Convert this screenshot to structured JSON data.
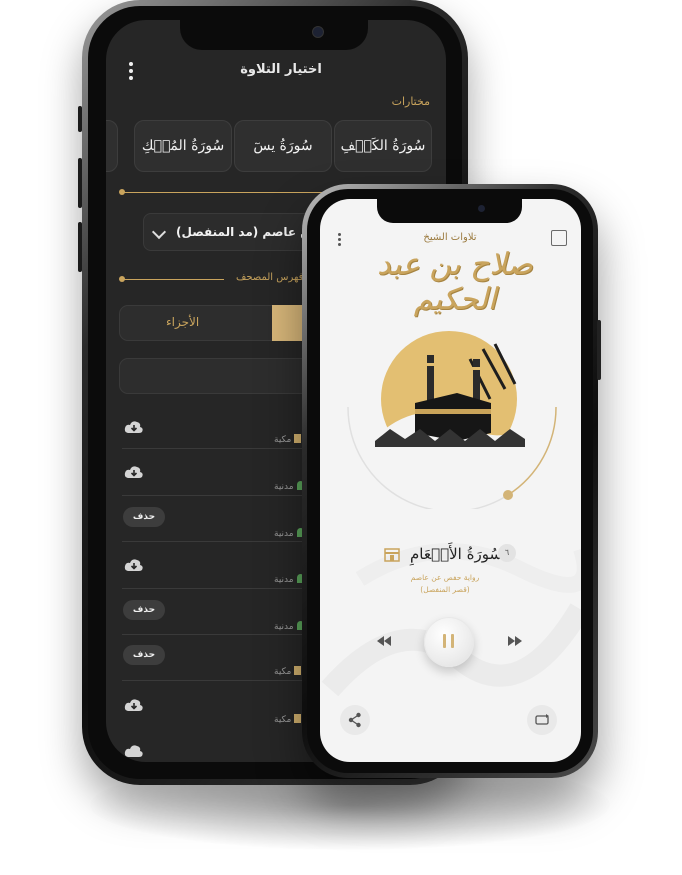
{
  "back_screen": {
    "title": "اختيار التلاوة",
    "favorites_label": "مختارات",
    "favorites": [
      "سُورَةُ الكَهۡفِ",
      "سُورَةُ يسٓ",
      "سُورَةُ المُلۡكِ"
    ],
    "riwaya_select": "عن عاصم (مد المنفصل)",
    "index_label": "فهرس المصحف",
    "tab_parts": "الأجزاء",
    "delete_label": "حذف",
    "rows": [
      {
        "type": "مكية",
        "action": "download"
      },
      {
        "type": "مدنية",
        "action": "download"
      },
      {
        "type": "مدنية",
        "action": "delete"
      },
      {
        "type": "مدنية",
        "action": "download"
      },
      {
        "type": "مدنية",
        "action": "delete"
      },
      {
        "type": "مكية",
        "action": "delete"
      },
      {
        "type": "مكية",
        "action": "download"
      }
    ]
  },
  "front_screen": {
    "title": "تلاوات الشيخ",
    "reciter_calligraphy": "صلاح بن عبد الحكيم",
    "surah_name": "سُورَةُ الأَنۡعَامِ",
    "surah_number": "٦",
    "riwaya_line1": "رواية حفص عن عاصم",
    "riwaya_line2": "(قصر المنفصل)"
  },
  "colors": {
    "gold": "#c9a45d",
    "dark": "#262626",
    "light": "#f4f4f4"
  },
  "icons": [
    "menu-icon",
    "book-icon",
    "kaaba-icon",
    "cloud-download-icon",
    "madina-icon",
    "pause-icon",
    "rewind-icon",
    "forward-icon",
    "share-icon",
    "repeat-icon"
  ]
}
